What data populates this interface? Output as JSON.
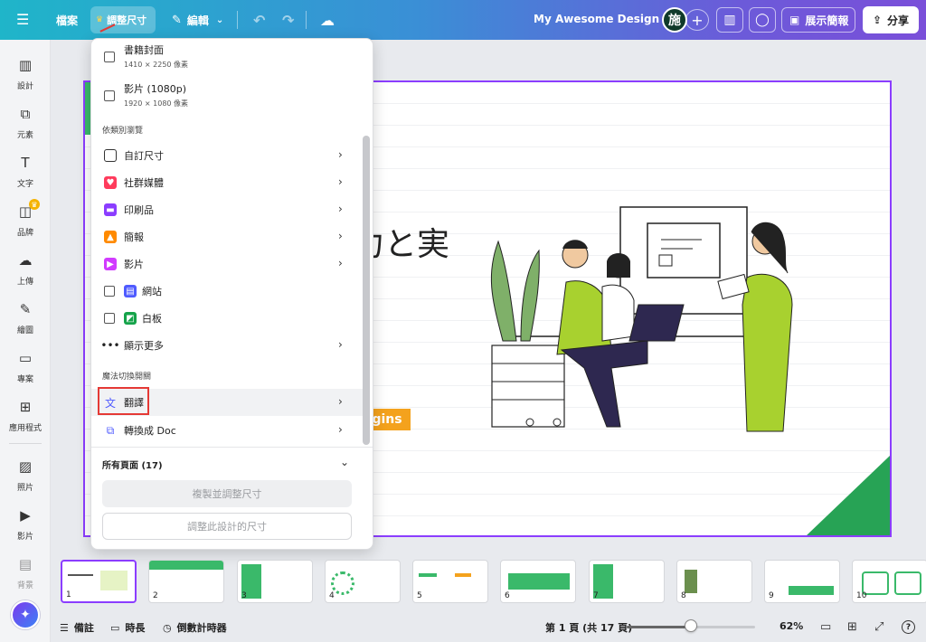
{
  "topbar": {
    "file_label": "檔案",
    "resize_label": "調整尺寸",
    "edit_label": "編輯",
    "design_title": "My Awesome Design 🤩",
    "avatar_initial": "施",
    "present_label": "展示簡報",
    "share_label": "分享"
  },
  "rail": {
    "items": [
      {
        "label": "設計",
        "icon": "layout-icon",
        "glyph": "▥"
      },
      {
        "label": "元素",
        "icon": "elements-icon",
        "glyph": "⧉"
      },
      {
        "label": "文字",
        "icon": "text-icon",
        "glyph": "T"
      },
      {
        "label": "品牌",
        "icon": "brand-icon",
        "glyph": "◫"
      },
      {
        "label": "上傳",
        "icon": "upload-icon",
        "glyph": "☁"
      },
      {
        "label": "繪圖",
        "icon": "draw-icon",
        "glyph": "✎"
      },
      {
        "label": "專案",
        "icon": "folder-icon",
        "glyph": "▭"
      },
      {
        "label": "應用程式",
        "icon": "apps-icon",
        "glyph": "⊞"
      },
      {
        "label": "照片",
        "icon": "photos-icon",
        "glyph": "▨"
      },
      {
        "label": "影片",
        "icon": "video-icon",
        "glyph": "▶"
      },
      {
        "label": "背景",
        "icon": "background-icon",
        "glyph": "▤"
      }
    ]
  },
  "slide": {
    "title": "力と実",
    "tag": "gins"
  },
  "dropdown": {
    "book_cover": {
      "label": "書籍封面",
      "size": "1410 × 2250 像素"
    },
    "video_1080": {
      "label": "影片 (1080p)",
      "size": "1920 × 1080 像素"
    },
    "browse_section": "依類別瀏覽",
    "categories": [
      {
        "label": "自訂尺寸",
        "icon": "custom-size-icon",
        "color": "#333333"
      },
      {
        "label": "社群媒體",
        "icon": "social-media-icon",
        "color": "#ff3b5c"
      },
      {
        "label": "印刷品",
        "icon": "print-icon",
        "color": "#8b3dff"
      },
      {
        "label": "簡報",
        "icon": "presentation-icon",
        "color": "#ff8a00"
      },
      {
        "label": "影片",
        "icon": "video-category-icon",
        "color": "#d13bff"
      },
      {
        "label": "網站",
        "icon": "website-icon",
        "color": "#4f5bff"
      },
      {
        "label": "白板",
        "icon": "whiteboard-icon",
        "color": "#15a34a"
      },
      {
        "label": "顯示更多",
        "icon": "more-icon",
        "color": "#222222"
      }
    ],
    "magic_section": "魔法切換開關",
    "translate_label": "翻譯",
    "convert_doc_label": "轉換成 Doc",
    "all_pages_label": "所有頁面 (17)",
    "copy_resize_button": "複製並調整尺寸",
    "resize_this_button": "調整此設計的尺寸"
  },
  "thumbnails": [
    "1",
    "2",
    "3",
    "4",
    "5",
    "6",
    "7",
    "8",
    "9",
    "10"
  ],
  "bottombar": {
    "notes_label": "備註",
    "duration_label": "時長",
    "timer_label": "倒數計時器",
    "page_indicator": "第 1 頁 (共 17 頁)",
    "zoom_percent": "62%",
    "zoom_fraction": 0.5
  },
  "colors": {
    "accent": "#8b3dff",
    "brand_green": "#27a355"
  }
}
